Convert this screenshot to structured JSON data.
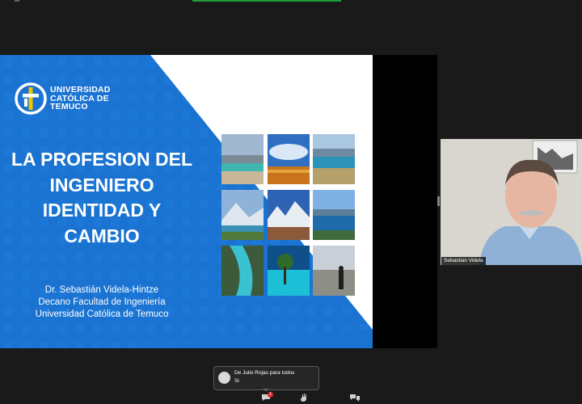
{
  "slide": {
    "logo": {
      "line1": "UNIVERSIDAD",
      "line2": "CATÓLICA DE",
      "line3": "TEMUCO"
    },
    "title": [
      "LA PROFESION DEL",
      "INGENIERO",
      "IDENTIDAD Y",
      "CAMBIO"
    ],
    "author": [
      "Dr. Sebastián Videla-Hintze",
      "Decano Facultad de Ingeniería",
      "Universidad Católica de Temuco"
    ],
    "photos": [
      "beach-lagoon",
      "flower-field",
      "lake-mountains",
      "mountain-lake",
      "rocky-peaks",
      "blue-lake",
      "glacier-river",
      "blue-ice-tree",
      "snowy-forest"
    ]
  },
  "participant": {
    "name": "Sebastian Videla"
  },
  "chat": {
    "header": "De Julio Rojas para todos",
    "message": "Si",
    "unread_count": "1"
  },
  "colors": {
    "slide_blue": "#1a72d1",
    "active_indicator": "#1f9e3a",
    "badge": "#e0262b"
  }
}
